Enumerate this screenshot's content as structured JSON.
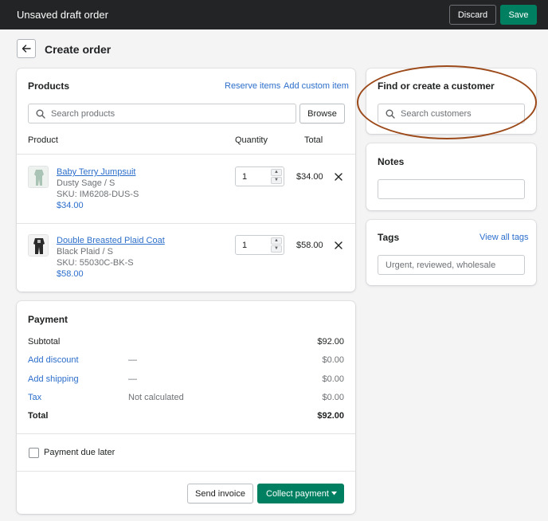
{
  "topbar": {
    "title": "Unsaved draft order",
    "discard_label": "Discard",
    "save_label": "Save"
  },
  "page": {
    "title": "Create order"
  },
  "products": {
    "title": "Products",
    "reserve_label": "Reserve items",
    "add_custom_label": "Add custom item",
    "search_placeholder": "Search products",
    "browse_label": "Browse",
    "columns": {
      "product": "Product",
      "quantity": "Quantity",
      "total": "Total"
    },
    "items": [
      {
        "name": "Baby Terry Jumpsuit",
        "variant": "Dusty Sage / S",
        "sku": "SKU: IM6208-DUS-S",
        "price": "$34.00",
        "quantity": "1",
        "total": "$34.00"
      },
      {
        "name": "Double Breasted Plaid Coat",
        "variant": "Black Plaid / S",
        "sku": "SKU: 55030C-BK-S",
        "price": "$58.00",
        "quantity": "1",
        "total": "$58.00"
      }
    ]
  },
  "payment": {
    "title": "Payment",
    "subtotal_label": "Subtotal",
    "subtotal_value": "$92.00",
    "discount_label": "Add discount",
    "discount_desc": "—",
    "discount_value": "$0.00",
    "shipping_label": "Add shipping",
    "shipping_desc": "—",
    "shipping_value": "$0.00",
    "tax_label": "Tax",
    "tax_desc": "Not calculated",
    "tax_value": "$0.00",
    "total_label": "Total",
    "total_value": "$92.00",
    "due_later_label": "Payment due later",
    "send_invoice_label": "Send invoice",
    "collect_payment_label": "Collect payment"
  },
  "customer": {
    "title": "Find or create a customer",
    "search_placeholder": "Search customers"
  },
  "notes": {
    "title": "Notes"
  },
  "tags": {
    "title": "Tags",
    "view_all_label": "View all tags",
    "placeholder": "Urgent, reviewed, wholesale"
  },
  "colors": {
    "accent": "#008060",
    "link": "#2c6ecb",
    "topbar": "#222425",
    "highlight_oval": "#9c4a1a"
  }
}
